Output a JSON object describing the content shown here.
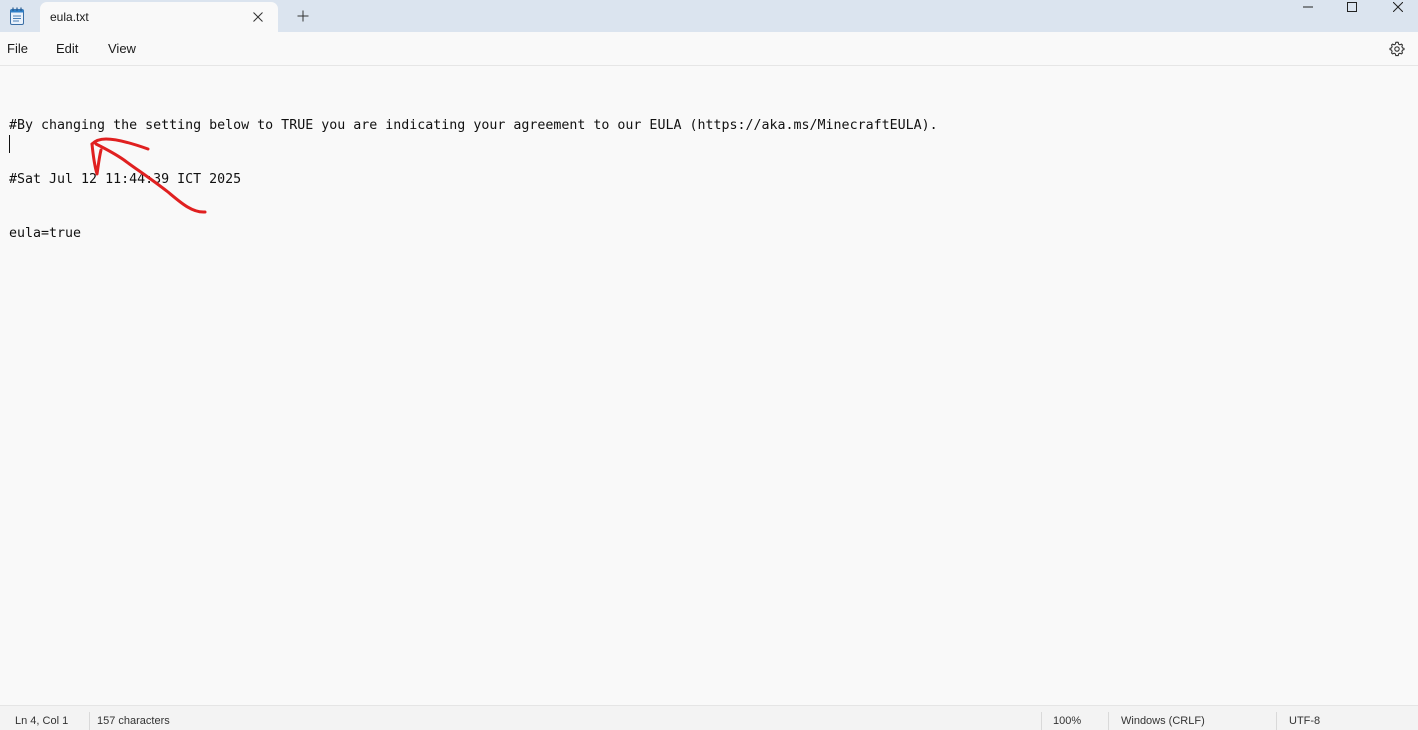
{
  "window": {
    "app_icon": "notepad-icon",
    "tab_title": "eula.txt",
    "tab_close_icon": "close-icon",
    "new_tab_icon": "plus-icon",
    "controls": [
      "minimize-icon",
      "maximize-icon",
      "close-icon"
    ]
  },
  "menu": {
    "file": "File",
    "edit": "Edit",
    "view": "View",
    "settings_icon": "gear-icon"
  },
  "editor": {
    "lines": [
      "#By changing the setting below to TRUE you are indicating your agreement to our EULA (https://aka.ms/MinecraftEULA).",
      "#Sat Jul 12 11:44:39 ICT 2025",
      "eula=true"
    ],
    "annotation": {
      "icon": "red-arrow-annotation",
      "color": "#e02020"
    }
  },
  "status": {
    "position": "Ln 4, Col 1",
    "characters": "157 characters",
    "zoom": "100%",
    "line_ending": "Windows (CRLF)",
    "encoding": "UTF-8"
  }
}
